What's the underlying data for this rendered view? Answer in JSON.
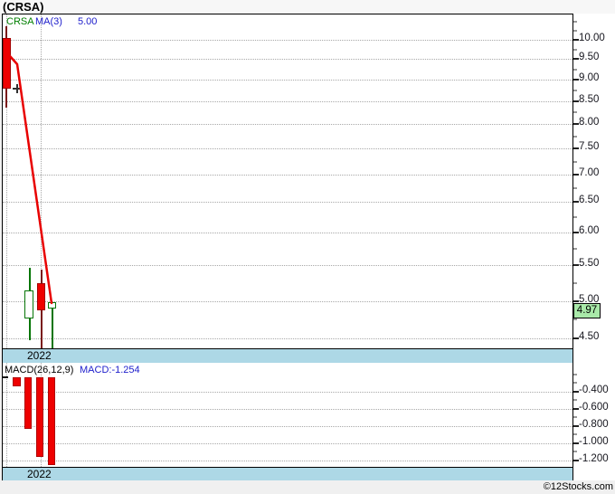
{
  "title": "(CRSA)",
  "price_panel": {
    "legend": {
      "symbol": "CRSA",
      "ma_label": "MA(3)",
      "ma_value": "5.00"
    },
    "y_axis_ticks": [
      "10.00",
      "9.50",
      "9.00",
      "8.50",
      "8.00",
      "7.50",
      "7.00",
      "6.50",
      "6.00",
      "5.50",
      "5.00",
      "4.50"
    ],
    "x_axis_year": "2022",
    "last_price_tag": "4.97"
  },
  "macd_panel": {
    "legend_label": "MACD(26,12,9)",
    "legend_value": "MACD:-1.254",
    "y_axis_ticks": [
      "-0.400",
      "-0.600",
      "-0.800",
      "-1.000",
      "-1.200"
    ],
    "x_axis_year": "2022"
  },
  "footer": {
    "copyright": "©12Stocks.com"
  },
  "colors": {
    "up_candle": "#057505",
    "down_candle": "#EE0000",
    "down_candle_wick": "#7A1A1A",
    "ma_line": "#E80000",
    "axis_band": "#ADD8E6",
    "price_tag_bg": "#A9E9A9",
    "legend_symbol_green": "#007F00",
    "legend_blue": "#2020CC",
    "grid": "#A8A8A8"
  },
  "chart_data": {
    "type": "candlestick",
    "symbol": "CRSA",
    "year": "2022",
    "price_scale": "log",
    "price_axis_range": [
      4.4,
      10.6
    ],
    "candles": [
      {
        "open": 10.05,
        "high": 10.36,
        "low": 8.35,
        "close": 8.78,
        "direction": "down"
      },
      {
        "open": 8.78,
        "high": 8.8,
        "low": 8.72,
        "close": 8.78,
        "direction": "doji"
      },
      {
        "open": 4.78,
        "high": 5.46,
        "low": 4.51,
        "close": 5.15,
        "direction": "up"
      },
      {
        "open": 5.25,
        "high": 5.44,
        "low": 4.41,
        "close": 4.88,
        "direction": "down"
      },
      {
        "open": 4.92,
        "high": 5.0,
        "low": 4.42,
        "close": 4.97,
        "direction": "up"
      }
    ],
    "ma3": [
      null,
      null,
      7.57,
      6.27,
      5.0
    ],
    "last_close": 4.97,
    "indicator": {
      "type": "macd_histogram",
      "params": [
        26,
        12,
        9
      ],
      "values": [
        null,
        -0.34,
        -0.83,
        -1.16,
        -1.254
      ],
      "last_value": -1.254,
      "axis_range": [
        -1.3,
        -0.22
      ]
    }
  }
}
